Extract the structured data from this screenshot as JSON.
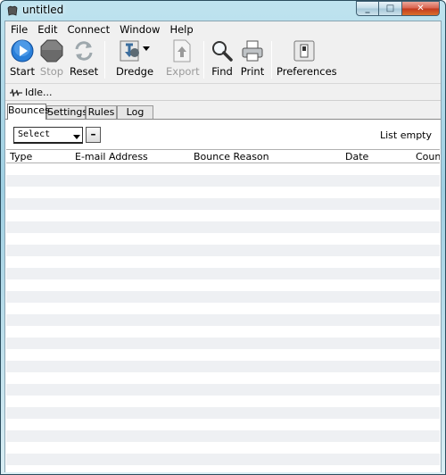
{
  "window": {
    "title": "untitled"
  },
  "menu": [
    "File",
    "Edit",
    "Connect",
    "Window",
    "Help"
  ],
  "toolbar": {
    "start": "Start",
    "stop": "Stop",
    "reset": "Reset",
    "dredge": "Dredge",
    "export": "Export",
    "find": "Find",
    "print": "Print",
    "preferences": "Preferences"
  },
  "status": {
    "text": "Idle..."
  },
  "tabs": [
    "Bounces",
    "Settings",
    "Rules",
    "Log"
  ],
  "filter": {
    "select_value": "Select",
    "remove_label": "–",
    "list_status": "List empty"
  },
  "table": {
    "columns": [
      "Type",
      "E-mail Address",
      "Bounce Reason",
      "Date",
      "Count"
    ]
  }
}
